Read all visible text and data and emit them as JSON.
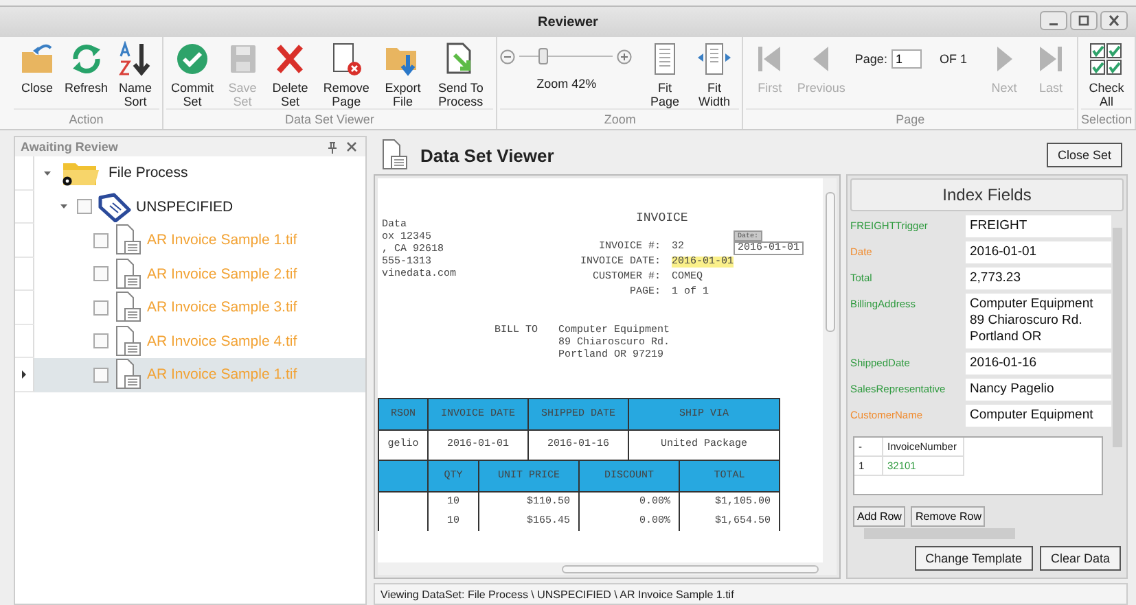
{
  "window": {
    "title": "Reviewer"
  },
  "ribbon": {
    "groups": [
      {
        "label": "Action",
        "buttons": [
          {
            "kind": "close",
            "label": "Close",
            "disabled": false
          },
          {
            "kind": "refresh",
            "label": "Refresh",
            "disabled": false
          },
          {
            "kind": "sort",
            "label": "Name Sort",
            "disabled": false
          }
        ]
      },
      {
        "label": "Data Set Viewer",
        "buttons": [
          {
            "kind": "commit",
            "label": "Commit Set",
            "disabled": false
          },
          {
            "kind": "save",
            "label": "Save Set",
            "disabled": true
          },
          {
            "kind": "delete",
            "label": "Delete Set",
            "disabled": false
          },
          {
            "kind": "remove-page",
            "label": "Remove Page",
            "disabled": false
          },
          {
            "kind": "export",
            "label": "Export File",
            "disabled": false
          },
          {
            "kind": "send",
            "label": "Send To Process",
            "disabled": false
          }
        ]
      },
      {
        "label": "Zoom",
        "zoom": {
          "level": 0.25,
          "label": "Zoom 42%"
        },
        "buttons": [
          {
            "kind": "fit-page",
            "label": "Fit Page",
            "disabled": false
          },
          {
            "kind": "fit-width",
            "label": "Fit Width",
            "disabled": false
          }
        ]
      },
      {
        "label": "Page",
        "pager": {
          "label": "Page:",
          "value": "1",
          "total": "OF 1"
        },
        "buttons": [
          {
            "kind": "first",
            "label": "First",
            "disabled": true
          },
          {
            "kind": "previous",
            "label": "Previous",
            "disabled": true
          },
          {
            "kind": "next",
            "label": "Next",
            "disabled": true
          },
          {
            "kind": "last",
            "label": "Last",
            "disabled": true
          }
        ]
      },
      {
        "label": "Selection",
        "buttons": [
          {
            "kind": "check-all",
            "label": "Check All",
            "disabled": false
          }
        ]
      }
    ]
  },
  "sidebar": {
    "title": "Awaiting Review",
    "tree": [
      {
        "kind": "folder",
        "label": "File Process",
        "expanded": true,
        "selected": false,
        "children": [
          {
            "kind": "tag",
            "label": "UNSPECIFIED",
            "expanded": true,
            "checked": false,
            "selected": false,
            "children": [
              {
                "kind": "file",
                "label": "AR Invoice Sample 1.tif",
                "checked": false,
                "selected": false
              },
              {
                "kind": "file",
                "label": "AR Invoice Sample 2.tif",
                "checked": false,
                "selected": false
              },
              {
                "kind": "file",
                "label": "AR Invoice Sample 3.tif",
                "checked": false,
                "selected": false
              },
              {
                "kind": "file",
                "label": "AR Invoice Sample 4.tif",
                "checked": false,
                "selected": false
              },
              {
                "kind": "file",
                "label": "AR Invoice Sample 1.tif",
                "checked": false,
                "selected": true
              }
            ]
          }
        ]
      }
    ]
  },
  "viewer": {
    "title": "Data Set Viewer",
    "close_button": "Close Set",
    "document": {
      "sender_lines": [
        "Data",
        "ox 12345",
        ", CA 92618",
        "555-1313",
        "vinedata.com"
      ],
      "heading": "INVOICE",
      "fields": [
        {
          "label": "INVOICE #:",
          "value": "32",
          "highlighted": false
        },
        {
          "label": "INVOICE DATE:",
          "value": "2016-01-01",
          "highlighted": true
        },
        {
          "label": "CUSTOMER #:",
          "value": "COMEQ",
          "highlighted": false
        },
        {
          "label": "PAGE:",
          "value": "1 of 1",
          "highlighted": false
        }
      ],
      "tooltip": {
        "label": "Date:",
        "value": "2016-01-01"
      },
      "bill_to": {
        "label": "BILL TO",
        "lines": [
          "Computer Equipment",
          "89 Chiaroscuro Rd.",
          "Portland OR 97219"
        ]
      },
      "tables": [
        {
          "headers": [
            "RSON",
            "INVOICE DATE",
            "SHIPPED DATE",
            "SHIP VIA"
          ],
          "rows": [
            [
              "gelio",
              "2016-01-01",
              "2016-01-16",
              "United Package"
            ]
          ]
        },
        {
          "headers": [
            "QTY",
            "UNIT PRICE",
            "DISCOUNT",
            "TOTAL"
          ],
          "rows": [
            [
              null,
              "10",
              "$110.50",
              "0.00%",
              "$1,105.00"
            ],
            [
              null,
              "10",
              "$165.45",
              "0.00%",
              "$1,654.50"
            ]
          ]
        }
      ]
    }
  },
  "index_fields": {
    "title": "Index Fields",
    "fields": [
      {
        "label": "FREIGHTTrigger",
        "color": "#2e9a3e",
        "value": "FREIGHT"
      },
      {
        "label": "Date",
        "color": "#f08a2c",
        "value": "2016-01-01"
      },
      {
        "label": "Total",
        "color": "#2e9a3e",
        "value": "2,773.23"
      },
      {
        "label": "BillingAddress",
        "color": "#2e9a3e",
        "value": "Computer Equipment\n89 Chiaroscuro Rd.\nPortland OR"
      },
      {
        "label": "ShippedDate",
        "color": "#2e9a3e",
        "value": "2016-01-16"
      },
      {
        "label": "SalesRepresentative",
        "color": "#2e9a3e",
        "value": "Nancy Pagelio"
      },
      {
        "label": "CustomerName",
        "color": "#f08a2c",
        "value": "Computer Equipment"
      }
    ],
    "grid": {
      "columns": [
        "-",
        "InvoiceNumber"
      ],
      "rows": [
        [
          "1",
          "32101"
        ]
      ]
    },
    "row_buttons": [
      "Add Row",
      "Remove Row"
    ],
    "buttons": [
      "Change Template",
      "Clear Data"
    ]
  },
  "status_bar": "Viewing DataSet: File Process \\ UNSPECIFIED \\ AR Invoice Sample 1.tif"
}
